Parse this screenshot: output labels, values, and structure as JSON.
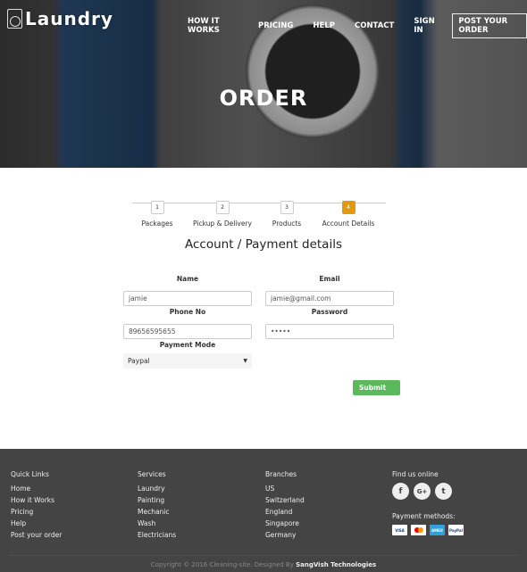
{
  "header": {
    "logo": "Laundry",
    "nav": [
      "HOW IT WORKS",
      "PRICING",
      "HELP",
      "CONTACT",
      "SIGN IN"
    ],
    "cta": "POST YOUR ORDER",
    "title": "ORDER"
  },
  "steps": [
    {
      "n": "1",
      "label": "Packages"
    },
    {
      "n": "2",
      "label": "Pickup & Delivery"
    },
    {
      "n": "3",
      "label": "Products"
    },
    {
      "n": "4",
      "label": "Account Details",
      "active": true
    }
  ],
  "form": {
    "heading": "Account / Payment details",
    "name": {
      "label": "Name",
      "value": "jamie"
    },
    "email": {
      "label": "Email",
      "value": "jamie@gmail.com"
    },
    "phone": {
      "label": "Phone No",
      "value": "89656595655"
    },
    "password": {
      "label": "Password",
      "value": "•••••"
    },
    "payment": {
      "label": "Payment Mode",
      "value": "Paypal"
    },
    "submit": "Submit"
  },
  "footer": {
    "quick": {
      "title": "Quick Links",
      "items": [
        "Home",
        "How it Works",
        "Pricing",
        "Help",
        "Post your order"
      ]
    },
    "services": {
      "title": "Services",
      "items": [
        "Laundry",
        "Painting",
        "Mechanic",
        "Wash",
        "Electricians"
      ]
    },
    "branches": {
      "title": "Branches",
      "items": [
        "US",
        "Switzerland",
        "England",
        "Singapore",
        "Germany"
      ]
    },
    "online": {
      "title": "Find us online",
      "icons": [
        "facebook-icon",
        "google-plus-icon",
        "twitter-icon"
      ],
      "payment_title": "Payment methods:",
      "payment": [
        "VISA",
        "mastercard",
        "AMEX",
        "PayPal"
      ]
    },
    "copyright": "Copyright © 2016 Cleaning-site. Designed By",
    "designer": "SangVish Technologies"
  },
  "colors": {
    "accent": "#e09a12",
    "submit": "#5cb85c",
    "footer": "#444444"
  }
}
